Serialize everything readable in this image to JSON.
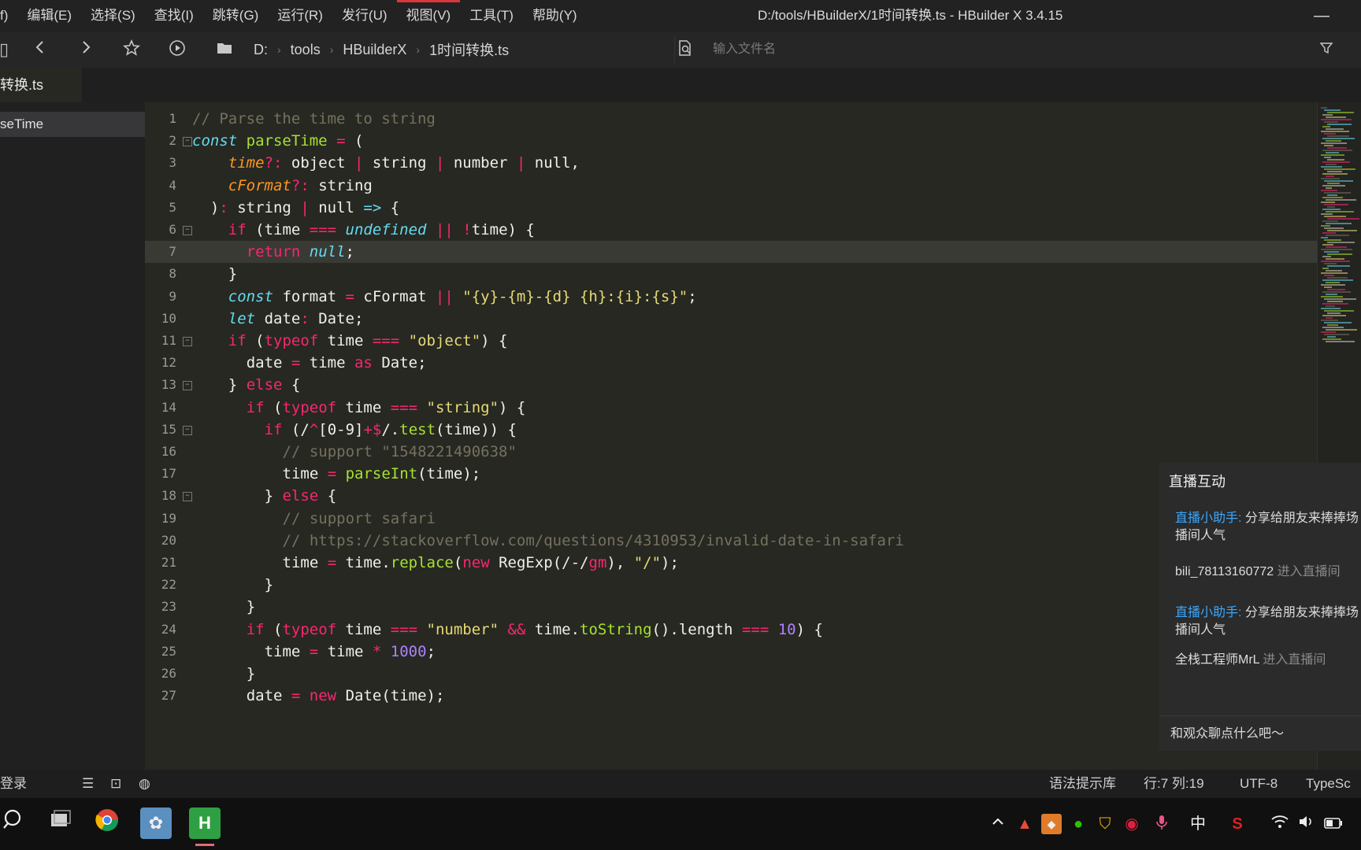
{
  "window": {
    "title": "D:/tools/HBuilderX/1时间转换.ts - HBuilder X 3.4.15",
    "minimize_glyph": "—"
  },
  "menu": [
    "f)",
    "编辑(E)",
    "选择(S)",
    "查找(I)",
    "跳转(G)",
    "运行(R)",
    "发行(U)",
    "视图(V)",
    "工具(T)",
    "帮助(Y)"
  ],
  "menu_active_index": 7,
  "toolbar": {
    "breadcrumb": [
      "D:",
      "tools",
      "HBuilderX",
      "1时间转换.ts"
    ],
    "file_search_placeholder": "输入文件名",
    "icons": [
      "left-edge-icon",
      "back-icon",
      "forward-icon",
      "star-icon",
      "run-icon",
      "folder-icon",
      "file-search-icon",
      "filter-icon"
    ]
  },
  "tab": {
    "label": "转换.ts"
  },
  "outline": {
    "items": [
      "seTime"
    ]
  },
  "editor": {
    "highlighted_line": 7,
    "lines": [
      {
        "n": "1",
        "fold": false,
        "indent": 0,
        "tokens": [
          [
            "c-com",
            "// Parse the time to string"
          ]
        ]
      },
      {
        "n": "2",
        "fold": true,
        "indent": 0,
        "tokens": [
          [
            "c-kw",
            "const"
          ],
          [
            "c-ty",
            " "
          ],
          [
            "c-fn",
            "parseTime"
          ],
          [
            "c-ty",
            " "
          ],
          [
            "c-op",
            "="
          ],
          [
            "c-ty",
            " ("
          ]
        ]
      },
      {
        "n": "3",
        "fold": false,
        "indent": 2,
        "tokens": [
          [
            "c-param",
            "time"
          ],
          [
            "c-op",
            "?:"
          ],
          [
            "c-ty",
            " object "
          ],
          [
            "c-op",
            "|"
          ],
          [
            "c-ty",
            " string "
          ],
          [
            "c-op",
            "|"
          ],
          [
            "c-ty",
            " number "
          ],
          [
            "c-op",
            "|"
          ],
          [
            "c-ty",
            " null,"
          ]
        ]
      },
      {
        "n": "4",
        "fold": false,
        "indent": 2,
        "tokens": [
          [
            "c-param",
            "cFormat"
          ],
          [
            "c-op",
            "?:"
          ],
          [
            "c-ty",
            " string"
          ]
        ]
      },
      {
        "n": "5",
        "fold": false,
        "indent": 1,
        "tokens": [
          [
            "c-ty",
            ")"
          ],
          [
            "c-op",
            ":"
          ],
          [
            "c-ty",
            " string "
          ],
          [
            "c-op",
            "|"
          ],
          [
            "c-ty",
            " null "
          ],
          [
            "c-kw",
            "=>"
          ],
          [
            "c-ty",
            " {"
          ]
        ]
      },
      {
        "n": "6",
        "fold": true,
        "indent": 2,
        "tokens": [
          [
            "c-op",
            "if"
          ],
          [
            "c-ty",
            " (time "
          ],
          [
            "c-op",
            "==="
          ],
          [
            "c-ty",
            " "
          ],
          [
            "c-kw",
            "undefined"
          ],
          [
            "c-ty",
            " "
          ],
          [
            "c-op",
            "||"
          ],
          [
            "c-ty",
            " "
          ],
          [
            "c-op",
            "!"
          ],
          [
            "c-ty",
            "time) {"
          ]
        ]
      },
      {
        "n": "7",
        "fold": false,
        "indent": 3,
        "tokens": [
          [
            "c-op",
            "return"
          ],
          [
            "c-ty",
            " "
          ],
          [
            "c-kw",
            "null"
          ],
          [
            "c-ty",
            ";"
          ]
        ]
      },
      {
        "n": "8",
        "fold": false,
        "indent": 2,
        "tokens": [
          [
            "c-ty",
            "}"
          ]
        ]
      },
      {
        "n": "9",
        "fold": false,
        "indent": 2,
        "tokens": [
          [
            "c-kw",
            "const"
          ],
          [
            "c-ty",
            " format "
          ],
          [
            "c-op",
            "="
          ],
          [
            "c-ty",
            " cFormat "
          ],
          [
            "c-op",
            "||"
          ],
          [
            "c-ty",
            " "
          ],
          [
            "c-str",
            "\"{y}-{m}-{d} {h}:{i}:{s}\""
          ],
          [
            "c-ty",
            ";"
          ]
        ]
      },
      {
        "n": "10",
        "fold": false,
        "indent": 2,
        "tokens": [
          [
            "c-kw",
            "let"
          ],
          [
            "c-ty",
            " date"
          ],
          [
            "c-op",
            ":"
          ],
          [
            "c-ty",
            " Date;"
          ]
        ]
      },
      {
        "n": "11",
        "fold": true,
        "indent": 2,
        "tokens": [
          [
            "c-op",
            "if"
          ],
          [
            "c-ty",
            " ("
          ],
          [
            "c-op",
            "typeof"
          ],
          [
            "c-ty",
            " time "
          ],
          [
            "c-op",
            "==="
          ],
          [
            "c-ty",
            " "
          ],
          [
            "c-str",
            "\"object\""
          ],
          [
            "c-ty",
            ") {"
          ]
        ]
      },
      {
        "n": "12",
        "fold": false,
        "indent": 3,
        "tokens": [
          [
            "c-ty",
            "date "
          ],
          [
            "c-op",
            "="
          ],
          [
            "c-ty",
            " time "
          ],
          [
            "c-op",
            "as"
          ],
          [
            "c-ty",
            " Date;"
          ]
        ]
      },
      {
        "n": "13",
        "fold": true,
        "indent": 2,
        "tokens": [
          [
            "c-ty",
            "} "
          ],
          [
            "c-op",
            "else"
          ],
          [
            "c-ty",
            " {"
          ]
        ]
      },
      {
        "n": "14",
        "fold": false,
        "indent": 3,
        "tokens": [
          [
            "c-op",
            "if"
          ],
          [
            "c-ty",
            " ("
          ],
          [
            "c-op",
            "typeof"
          ],
          [
            "c-ty",
            " time "
          ],
          [
            "c-op",
            "==="
          ],
          [
            "c-ty",
            " "
          ],
          [
            "c-str",
            "\"string\""
          ],
          [
            "c-ty",
            ") {"
          ]
        ]
      },
      {
        "n": "15",
        "fold": true,
        "indent": 4,
        "tokens": [
          [
            "c-op",
            "if"
          ],
          [
            "c-ty",
            " (/"
          ],
          [
            "c-op",
            "^"
          ],
          [
            "c-ty",
            "[0-9]"
          ],
          [
            "c-op",
            "+$"
          ],
          [
            "c-ty",
            "/."
          ],
          [
            "c-fn",
            "test"
          ],
          [
            "c-ty",
            "(time)) {"
          ]
        ]
      },
      {
        "n": "16",
        "fold": false,
        "indent": 5,
        "tokens": [
          [
            "c-com",
            "// support \"1548221490638\""
          ]
        ]
      },
      {
        "n": "17",
        "fold": false,
        "indent": 5,
        "tokens": [
          [
            "c-ty",
            "time "
          ],
          [
            "c-op",
            "="
          ],
          [
            "c-ty",
            " "
          ],
          [
            "c-fn",
            "parseInt"
          ],
          [
            "c-ty",
            "(time);"
          ]
        ]
      },
      {
        "n": "18",
        "fold": true,
        "indent": 4,
        "tokens": [
          [
            "c-ty",
            "} "
          ],
          [
            "c-op",
            "else"
          ],
          [
            "c-ty",
            " {"
          ]
        ]
      },
      {
        "n": "19",
        "fold": false,
        "indent": 5,
        "tokens": [
          [
            "c-com",
            "// support safari"
          ]
        ]
      },
      {
        "n": "20",
        "fold": false,
        "indent": 5,
        "tokens": [
          [
            "c-com",
            "// https://stackoverflow.com/questions/4310953/invalid-date-in-safari"
          ]
        ]
      },
      {
        "n": "21",
        "fold": false,
        "indent": 5,
        "tokens": [
          [
            "c-ty",
            "time "
          ],
          [
            "c-op",
            "="
          ],
          [
            "c-ty",
            " time."
          ],
          [
            "c-fn",
            "replace"
          ],
          [
            "c-ty",
            "("
          ],
          [
            "c-op",
            "new"
          ],
          [
            "c-ty",
            " RegExp(/-/"
          ],
          [
            "c-op",
            "gm"
          ],
          [
            "c-ty",
            "), "
          ],
          [
            "c-str",
            "\"/\""
          ],
          [
            "c-ty",
            ");"
          ]
        ]
      },
      {
        "n": "22",
        "fold": false,
        "indent": 4,
        "tokens": [
          [
            "c-ty",
            "}"
          ]
        ]
      },
      {
        "n": "23",
        "fold": false,
        "indent": 3,
        "tokens": [
          [
            "c-ty",
            "}"
          ]
        ]
      },
      {
        "n": "24",
        "fold": false,
        "indent": 3,
        "tokens": [
          [
            "c-op",
            "if"
          ],
          [
            "c-ty",
            " ("
          ],
          [
            "c-op",
            "typeof"
          ],
          [
            "c-ty",
            " time "
          ],
          [
            "c-op",
            "==="
          ],
          [
            "c-ty",
            " "
          ],
          [
            "c-str",
            "\"number\""
          ],
          [
            "c-ty",
            " "
          ],
          [
            "c-op",
            "&&"
          ],
          [
            "c-ty",
            " time."
          ],
          [
            "c-fn",
            "toString"
          ],
          [
            "c-ty",
            "().length "
          ],
          [
            "c-op",
            "==="
          ],
          [
            "c-ty",
            " "
          ],
          [
            "c-num",
            "10"
          ],
          [
            "c-ty",
            ") {"
          ]
        ]
      },
      {
        "n": "25",
        "fold": false,
        "indent": 4,
        "tokens": [
          [
            "c-ty",
            "time "
          ],
          [
            "c-op",
            "="
          ],
          [
            "c-ty",
            " time "
          ],
          [
            "c-op",
            "*"
          ],
          [
            "c-ty",
            " "
          ],
          [
            "c-num",
            "1000"
          ],
          [
            "c-ty",
            ";"
          ]
        ]
      },
      {
        "n": "26",
        "fold": false,
        "indent": 3,
        "tokens": [
          [
            "c-ty",
            "}"
          ]
        ]
      },
      {
        "n": "27",
        "fold": false,
        "indent": 3,
        "tokens": [
          [
            "c-ty",
            "date "
          ],
          [
            "c-op",
            "="
          ],
          [
            "c-ty",
            " "
          ],
          [
            "c-op",
            "new"
          ],
          [
            "c-ty",
            " Date(time);"
          ]
        ]
      }
    ]
  },
  "live_panel": {
    "header": "直播互动",
    "messages": [
      {
        "name": "直播小助手:",
        "text": " 分享给朋友来捧捧场播间人气",
        "style": "assistant"
      },
      {
        "name": "bili_78113160772",
        "text": " 进入直播间",
        "style": "user"
      },
      {
        "name": "直播小助手:",
        "text": " 分享给朋友来捧捧场播间人气",
        "style": "assistant"
      },
      {
        "name": "全栈工程师MrL",
        "text": " 进入直播间",
        "style": "user"
      }
    ],
    "input_placeholder": "和观众聊点什么吧～"
  },
  "statusbar": {
    "left_text": "登录",
    "syntax_lib": "语法提示库",
    "position": "行:7  列:19",
    "encoding": "UTF-8",
    "language": "TypeSc"
  },
  "taskbar": {
    "apps": [
      "search-icon",
      "task-view-icon",
      "chrome-icon",
      "game-app-icon",
      "hbuilderx-icon"
    ],
    "tray": [
      "chevron-up-icon",
      "app-tray-icon",
      "tray-app-icon",
      "wechat-icon",
      "shield-icon",
      "netease-icon",
      "mic-icon"
    ],
    "ime": "中",
    "tray2": [
      "sogou-icon",
      "wifi-icon",
      "volume-icon",
      "battery-icon"
    ]
  },
  "colors": {
    "editor_bg": "#272822",
    "keyword": "#66d9ef",
    "function": "#a6e22e",
    "operator": "#f92672",
    "string": "#e6db74",
    "number": "#ae81ff",
    "comment": "#75715e",
    "param": "#fd971f",
    "menu_accent": "#d9383a",
    "link_blue": "#3aa7ff"
  }
}
